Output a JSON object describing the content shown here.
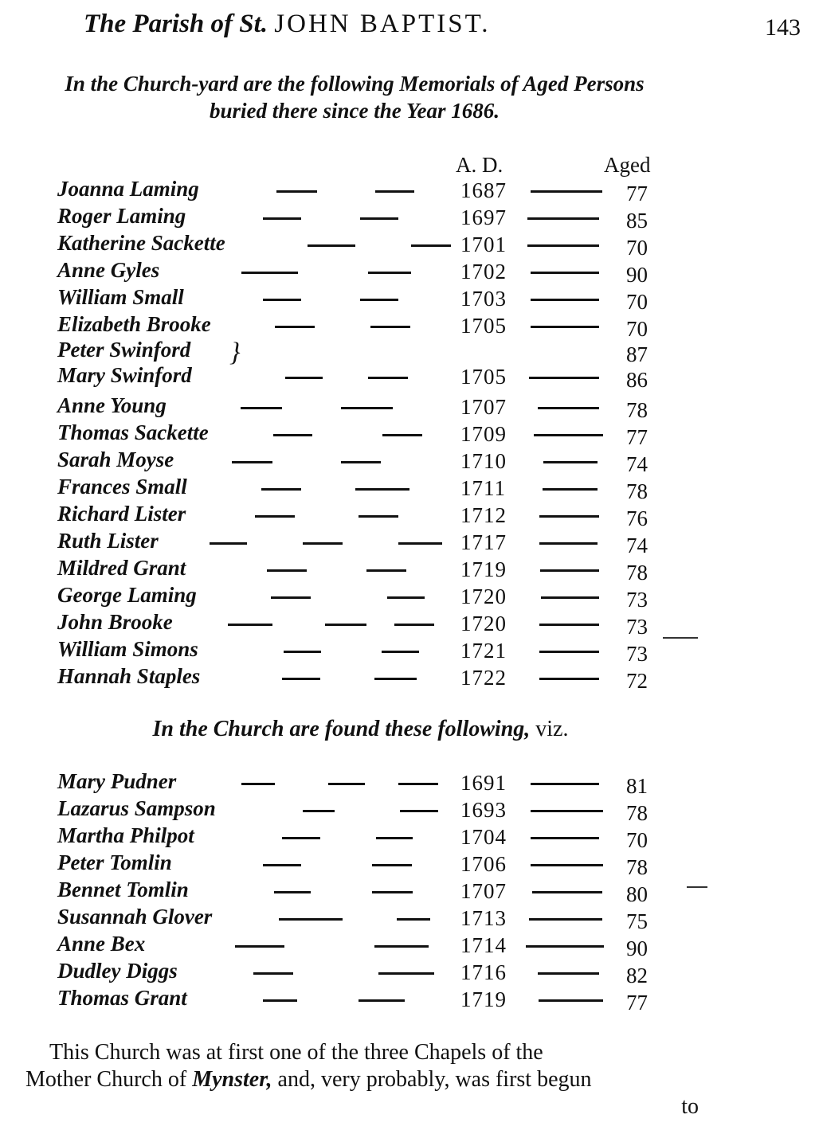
{
  "header": {
    "title_italic": "The Parish of St.",
    "title_caps": "JOHN BAPTIST.",
    "page_number": "143"
  },
  "intro": {
    "line1": "In the Church-yard are the following Memorials of Aged Persons",
    "line2": "buried there since the Year 1686."
  },
  "columns": {
    "year": "A. D.",
    "age": "Aged"
  },
  "churchyard": [
    {
      "name": "Joanna Laming",
      "year": "1687",
      "age": "77"
    },
    {
      "name": "Roger Laming",
      "year": "1697",
      "age": "85"
    },
    {
      "name": "Katherine Sackette",
      "year": "1701",
      "age": "70"
    },
    {
      "name": "Anne Gyles",
      "year": "1702",
      "age": "90"
    },
    {
      "name": "William Small",
      "year": "1703",
      "age": "70"
    },
    {
      "name": "Elizabeth Brooke",
      "year": "1705",
      "age": "70"
    },
    {
      "name": "Peter Swinford",
      "year": "",
      "age": "87"
    },
    {
      "name": "Mary Swinford",
      "year": "1705",
      "age": "86"
    },
    {
      "name": "Anne Young",
      "year": "1707",
      "age": "78"
    },
    {
      "name": "Thomas Sackette",
      "year": "1709",
      "age": "77"
    },
    {
      "name": "Sarah Moyse",
      "year": "1710",
      "age": "74"
    },
    {
      "name": "Frances Small",
      "year": "1711",
      "age": "78"
    },
    {
      "name": "Richard Lister",
      "year": "1712",
      "age": "76"
    },
    {
      "name": "Ruth Lister",
      "year": "1717",
      "age": "74"
    },
    {
      "name": "Mildred Grant",
      "year": "1719",
      "age": "78"
    },
    {
      "name": "George Laming",
      "year": "1720",
      "age": "73"
    },
    {
      "name": "John Brooke",
      "year": "1720",
      "age": "73"
    },
    {
      "name": "William Simons",
      "year": "1721",
      "age": "73"
    },
    {
      "name": "Hannah Staples",
      "year": "1722",
      "age": "72"
    }
  ],
  "church_heading": {
    "text": "In the Church are found these following,",
    "viz": "viz."
  },
  "church": [
    {
      "name": "Mary Pudner",
      "year": "1691",
      "age": "81"
    },
    {
      "name": "Lazarus Sampson",
      "year": "1693",
      "age": "78"
    },
    {
      "name": "Martha Philpot",
      "year": "1704",
      "age": "70"
    },
    {
      "name": "Peter Tomlin",
      "year": "1706",
      "age": "78"
    },
    {
      "name": "Bennet Tomlin",
      "year": "1707",
      "age": "80"
    },
    {
      "name": "Susannah Glover",
      "year": "1713",
      "age": "75"
    },
    {
      "name": "Anne Bex",
      "year": "1714",
      "age": "90"
    },
    {
      "name": "Dudley Diggs",
      "year": "1716",
      "age": "82"
    },
    {
      "name": "Thomas Grant",
      "year": "1719",
      "age": "77"
    }
  ],
  "paragraph": {
    "line1": "This Church was at first one of the three Chapels of the",
    "line2_a": "Mother Church of",
    "line2_italic": "Mynster,",
    "line2_b": "and, very probably, was first begun",
    "catchword": "to"
  }
}
